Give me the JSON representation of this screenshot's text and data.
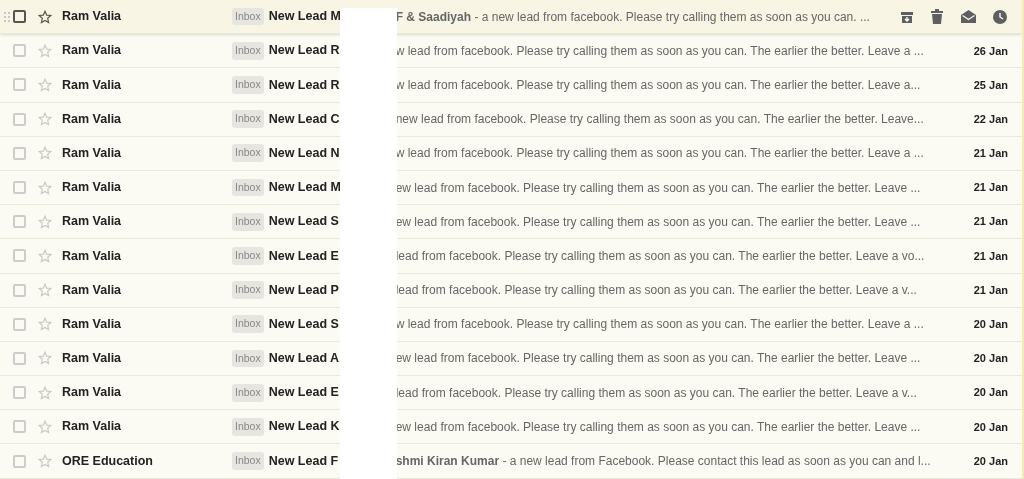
{
  "rows": [
    {
      "sender": "Ram Valia",
      "label": "Inbox",
      "subject": "New Lead M",
      "snippet": "**F & Saadiyah** - a new lead from facebook. Please try calling them as soon as you can. ...",
      "hovered": true
    },
    {
      "sender": "Ram Valia",
      "label": "Inbox",
      "subject": "New Lead R",
      "snippet": "w lead from facebook. Please try calling them as soon as you can. The earlier the better. Leave a ...",
      "date": "26 Jan",
      "hovered": false
    },
    {
      "sender": "Ram Valia",
      "label": "Inbox",
      "subject": "New Lead R",
      "snippet": "w lead from facebook. Please try calling them as soon as you can. The earlier the better. Leave a...",
      "date": "25 Jan",
      "hovered": false
    },
    {
      "sender": "Ram Valia",
      "label": "Inbox",
      "subject": "New Lead C",
      "snippet": "new lead from facebook. Please try calling them as soon as you can. The earlier the better. Leave...",
      "date": "22 Jan",
      "hovered": false
    },
    {
      "sender": "Ram Valia",
      "label": "Inbox",
      "subject": "New Lead N",
      "snippet": "w lead from facebook. Please try calling them as soon as you can. The earlier the better. Leave a ...",
      "date": "21 Jan",
      "hovered": false
    },
    {
      "sender": "Ram Valia",
      "label": "Inbox",
      "subject": "New Lead M",
      "snippet": "ew lead from facebook. Please try calling them as soon as you can. The earlier the better. Leave ...",
      "date": "21 Jan",
      "hovered": false
    },
    {
      "sender": "Ram Valia",
      "label": "Inbox",
      "subject": "New Lead S",
      "snippet": "ew lead from facebook. Please try calling them as soon as you can. The earlier the better. Leave ...",
      "date": "21 Jan",
      "hovered": false
    },
    {
      "sender": "Ram Valia",
      "label": "Inbox",
      "subject": "New Lead E",
      "snippet": "lead from facebook. Please try calling them as soon as you can. The earlier the better. Leave a vo...",
      "date": "21 Jan",
      "hovered": false
    },
    {
      "sender": "Ram Valia",
      "label": "Inbox",
      "subject": "New Lead P",
      "snippet": "lead from facebook. Please try calling them as soon as you can. The earlier the better. Leave a v...",
      "date": "21 Jan",
      "hovered": false
    },
    {
      "sender": "Ram Valia",
      "label": "Inbox",
      "subject": "New Lead S",
      "snippet": "w lead from facebook. Please try calling them as soon as you can. The earlier the better. Leave a ...",
      "date": "20 Jan",
      "hovered": false
    },
    {
      "sender": "Ram Valia",
      "label": "Inbox",
      "subject": "New Lead A",
      "snippet": "ew lead from facebook. Please try calling them as soon as you can. The earlier the better. Leave ...",
      "date": "20 Jan",
      "hovered": false
    },
    {
      "sender": "Ram Valia",
      "label": "Inbox",
      "subject": "New Lead E",
      "snippet": "lead from facebook. Please try calling them as soon as you can. The earlier the better. Leave a v...",
      "date": "20 Jan",
      "hovered": false
    },
    {
      "sender": "Ram Valia",
      "label": "Inbox",
      "subject": "New Lead K",
      "snippet": "ew lead from facebook. Please try calling them as soon as you can. The earlier the better. Leave ...",
      "date": "20 Jan",
      "hovered": false
    },
    {
      "sender": "ORE Education",
      "label": "Inbox",
      "subject": "New Lead F",
      "snippet": "**shmi Kiran Kumar** - a new lead from Facebook. Please contact this lead as soon as you can and l...",
      "date": "20 Jan",
      "hovered": false
    }
  ]
}
